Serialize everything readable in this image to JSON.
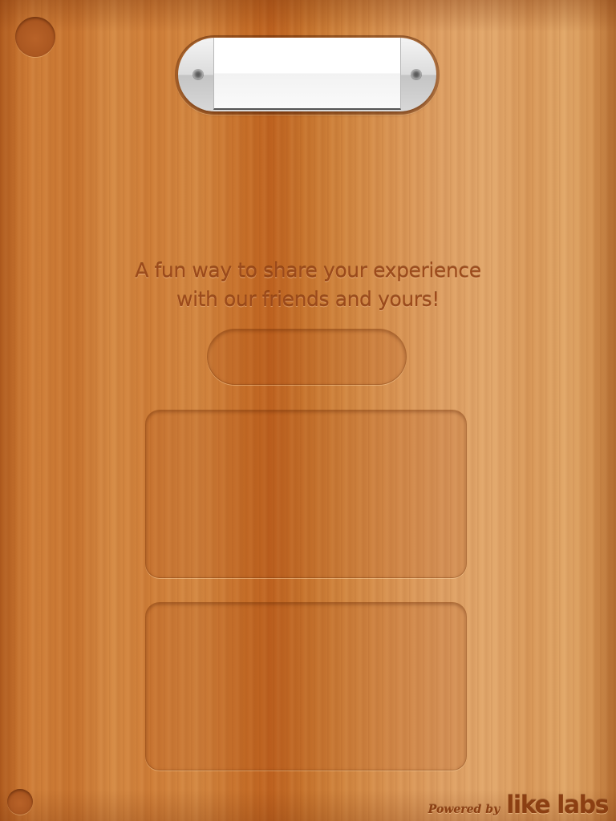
{
  "board": {
    "tagline_line1": "A fun way to share your experience",
    "tagline_line2": "with our friends and yours!"
  },
  "nameplate": {
    "label": ""
  },
  "footer": {
    "powered_by": "Powered by",
    "brand": "like labs"
  },
  "colors": {
    "wood_base": "#d08038",
    "engraved_text": "#9c4a1b",
    "plaque_metal": "#dcdcdc"
  }
}
